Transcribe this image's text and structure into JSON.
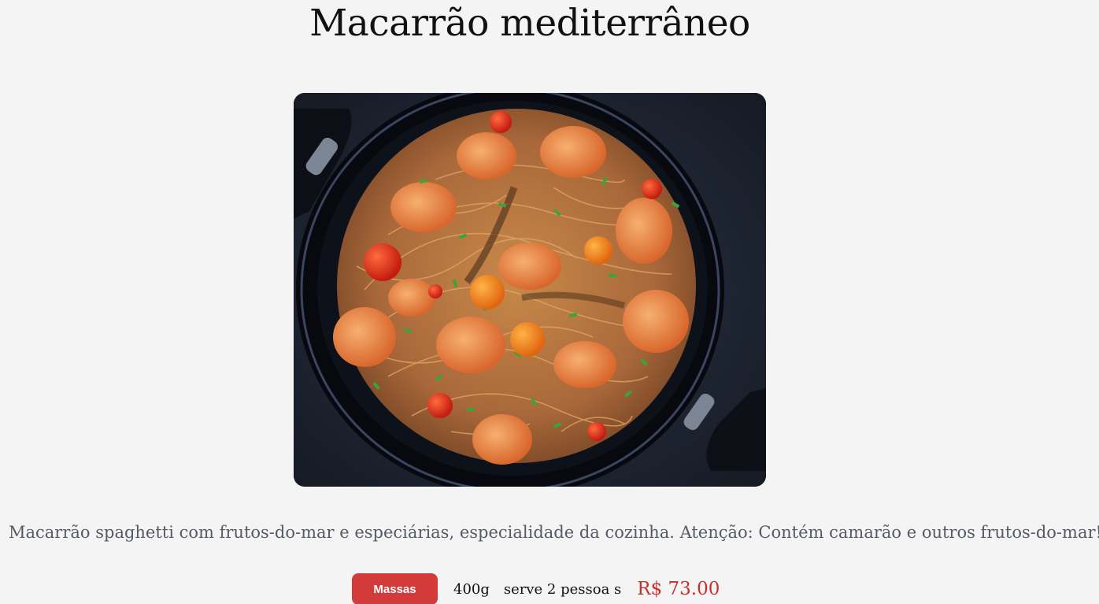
{
  "product": {
    "title": "Macarrão mediterrâneo",
    "description": "Macarrão spaghetti com frutos-do-mar e especiárias, especialidade da cozinha. Atenção: Contém camarão e outros frutos-do-mar!",
    "category": "Massas",
    "weight": "400g",
    "serves": "serve 2 pessoa s",
    "price": "R$ 73.00"
  },
  "colors": {
    "background": "#f4f4f4",
    "accent": "#d33a3a",
    "price": "#c9302c",
    "description_text": "#555a66"
  },
  "icons": {
    "photo": "pasta-dish-photo"
  }
}
